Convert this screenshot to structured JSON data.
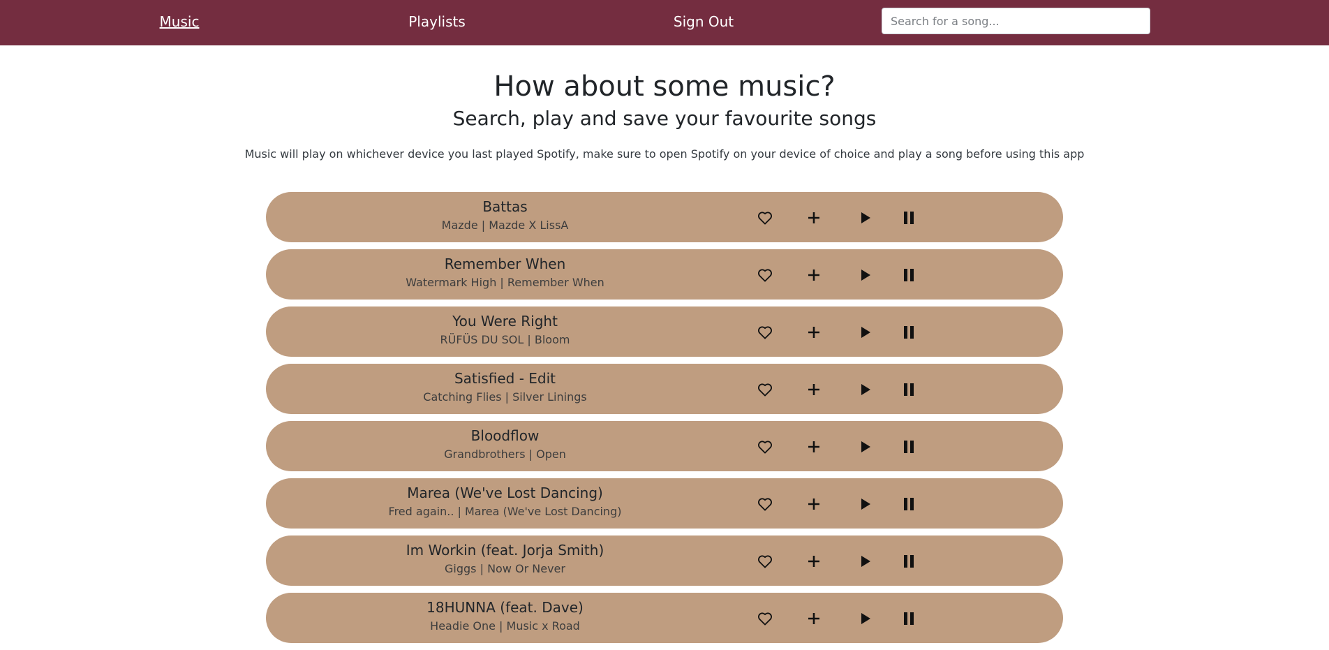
{
  "nav": {
    "music": "Music",
    "playlists": "Playlists",
    "sign_out": "Sign Out",
    "search_placeholder": "Search for a song..."
  },
  "hero": {
    "title": "How about some music?",
    "subtitle": "Search, play and save your favourite songs",
    "note": "Music will play on whichever device you last played Spotify, make sure to open Spotify on your device of choice and play a song before using this app"
  },
  "songs": [
    {
      "title": "Battas",
      "meta": "Mazde | Mazde X LissA"
    },
    {
      "title": "Remember When",
      "meta": "Watermark High | Remember When"
    },
    {
      "title": "You Were Right",
      "meta": "RÜFÜS DU SOL | Bloom"
    },
    {
      "title": "Satisfied - Edit",
      "meta": "Catching Flies | Silver Linings"
    },
    {
      "title": "Bloodflow",
      "meta": "Grandbrothers | Open"
    },
    {
      "title": "Marea (We've Lost Dancing)",
      "meta": "Fred again.. | Marea (We've Lost Dancing)"
    },
    {
      "title": "Im Workin (feat. Jorja Smith)",
      "meta": "Giggs | Now Or Never"
    },
    {
      "title": "18HUNNA (feat. Dave)",
      "meta": "Headie One | Music x Road"
    }
  ],
  "colors": {
    "navbar": "#742d40",
    "song_card": "#bf9d80"
  },
  "icons": [
    "heart-icon",
    "plus-icon",
    "play-icon",
    "pause-icon"
  ]
}
